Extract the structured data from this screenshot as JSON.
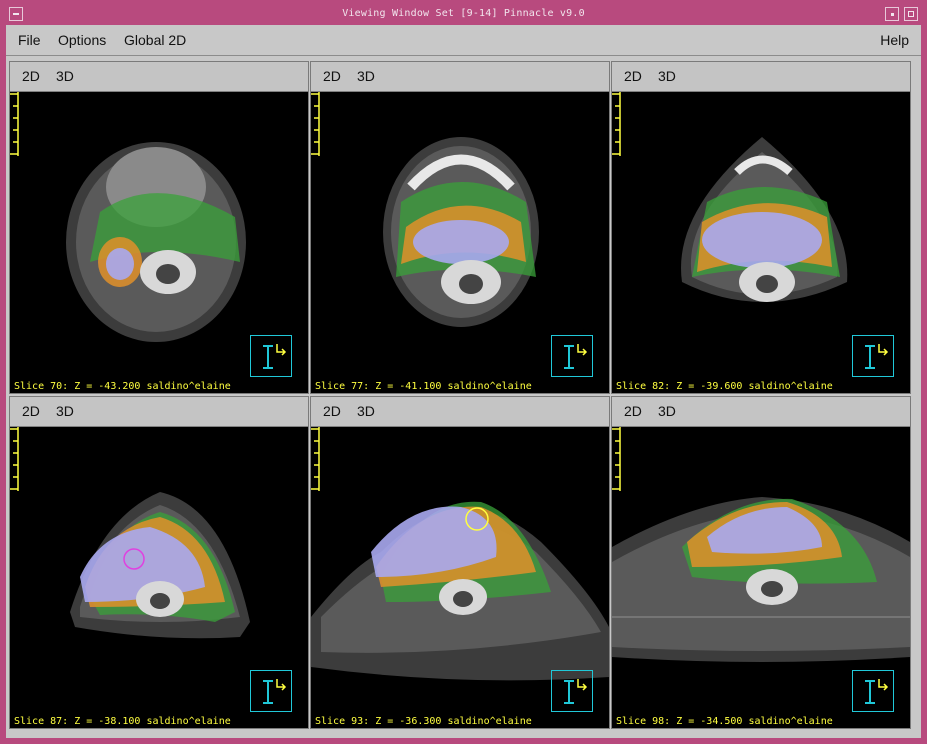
{
  "window": {
    "title": "Viewing Window Set [9-14]     Pinnacle v9.0"
  },
  "menubar": {
    "items": [
      "File",
      "Options",
      "Global 2D"
    ],
    "help": "Help"
  },
  "panels": [
    {
      "tab_2d": "2D",
      "tab_3d": "3D",
      "slice_label": "Slice 70: Z = -43.200 saldino^elaine"
    },
    {
      "tab_2d": "2D",
      "tab_3d": "3D",
      "slice_label": "Slice 77: Z = -41.100 saldino^elaine"
    },
    {
      "tab_2d": "2D",
      "tab_3d": "3D",
      "slice_label": "Slice 82: Z = -39.600 saldino^elaine"
    },
    {
      "tab_2d": "2D",
      "tab_3d": "3D",
      "slice_label": "Slice 87: Z = -38.100 saldino^elaine"
    },
    {
      "tab_2d": "2D",
      "tab_3d": "3D",
      "slice_label": "Slice 93: Z = -36.300 saldino^elaine"
    },
    {
      "tab_2d": "2D",
      "tab_3d": "3D",
      "slice_label": "Slice 98: Z = -34.500 saldino^elaine"
    }
  ],
  "colors": {
    "frame": "#b84a7e",
    "label_text": "#ffff40",
    "orientation_marker": "#20c8d8",
    "contour_green": "#3aa23a",
    "contour_orange": "#e0902a",
    "contour_lavender": "#a8a8f0"
  },
  "icons": {
    "orientation": "patient-orientation-icon",
    "scale": "ruler-scale-icon"
  }
}
